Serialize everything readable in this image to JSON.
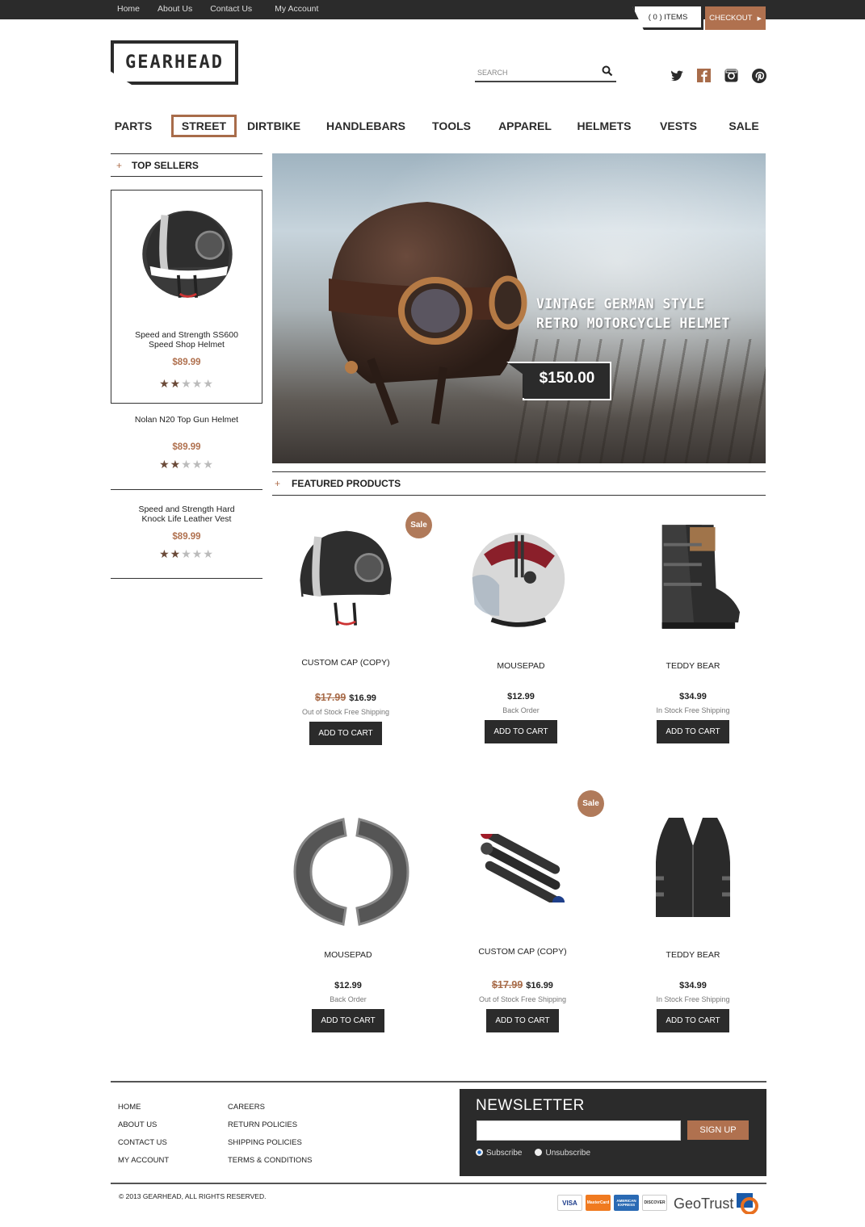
{
  "topbar": {
    "links": [
      "Home",
      "About Us",
      "Contact Us",
      "My Account"
    ],
    "cart_items": "( 0 )  ITEMS",
    "checkout_label": "CHECKOUT"
  },
  "header": {
    "logo_text": "GEARHEAD",
    "search_placeholder": "SEARCH"
  },
  "nav": {
    "items": [
      "PARTS",
      "STREET",
      "DIRTBIKE",
      "HANDLEBARS",
      "TOOLS",
      "APPAREL",
      "HELMETS",
      "VESTS",
      "SALE"
    ],
    "active": "STREET"
  },
  "sidebar": {
    "title": "TOP SELLERS",
    "products": [
      {
        "name_line1": "Speed and Strength SS600",
        "name_line2": "Speed Shop Helmet",
        "price": "$89.99",
        "rating": 2
      },
      {
        "name_line1": "Nolan N20 Top Gun Helmet",
        "name_line2": "",
        "price": "$89.99",
        "rating": 2
      },
      {
        "name_line1": "Speed and Strength Hard",
        "name_line2": "Knock Life Leather Vest",
        "price": "$89.99",
        "rating": 2
      }
    ]
  },
  "hero": {
    "headline_line1": "VINTAGE GERMAN STYLE",
    "headline_line2": "RETRO MOTORCYCLE HELMET",
    "price": "$150.00"
  },
  "featured": {
    "title": "FEATURED PRODUCTS",
    "sale_badge": "Sale",
    "button_label": "ADD TO CART",
    "products": [
      {
        "name": "CUSTOM CAP (COPY)",
        "old_price": "$17.99",
        "price": "$16.99",
        "stock": "Out of Stock Free Shipping",
        "sale": true
      },
      {
        "name": "MOUSEPAD",
        "old_price": "",
        "price": "$12.99",
        "stock": "Back Order",
        "sale": false
      },
      {
        "name": "TEDDY BEAR",
        "old_price": "",
        "price": "$34.99",
        "stock": "In Stock Free Shipping",
        "sale": false
      },
      {
        "name": "MOUSEPAD",
        "old_price": "",
        "price": "$12.99",
        "stock": "Back Order",
        "sale": false
      },
      {
        "name": "CUSTOM CAP (COPY)",
        "old_price": "$17.99",
        "price": "$16.99",
        "stock": "Out of Stock Free Shipping",
        "sale": true
      },
      {
        "name": "TEDDY BEAR",
        "old_price": "",
        "price": "$34.99",
        "stock": "In Stock Free Shipping",
        "sale": false
      }
    ]
  },
  "footer": {
    "col1": [
      "HOME",
      "ABOUT US",
      "CONTACT US",
      "MY ACCOUNT"
    ],
    "col2": [
      "CAREERS",
      "RETURN POLICIES",
      "SHIPPING POLICIES",
      "TERMS & CONDITIONS"
    ],
    "newsletter_title": "NEWSLETTER",
    "signup_label": "SIGN UP",
    "subscribe_label": "Subscribe",
    "unsubscribe_label": "Unsubscribe",
    "copyright": "© 2013 GEARHEAD, ALL RIGHTS RESERVED.",
    "payment_cards": [
      "VISA",
      "MasterCard",
      "AMERICAN EXPRESS",
      "DISCOVER"
    ],
    "trust_seal": "GeoTrust"
  },
  "colors": {
    "accent": "#b0714f",
    "dark": "#2b2b2b"
  }
}
